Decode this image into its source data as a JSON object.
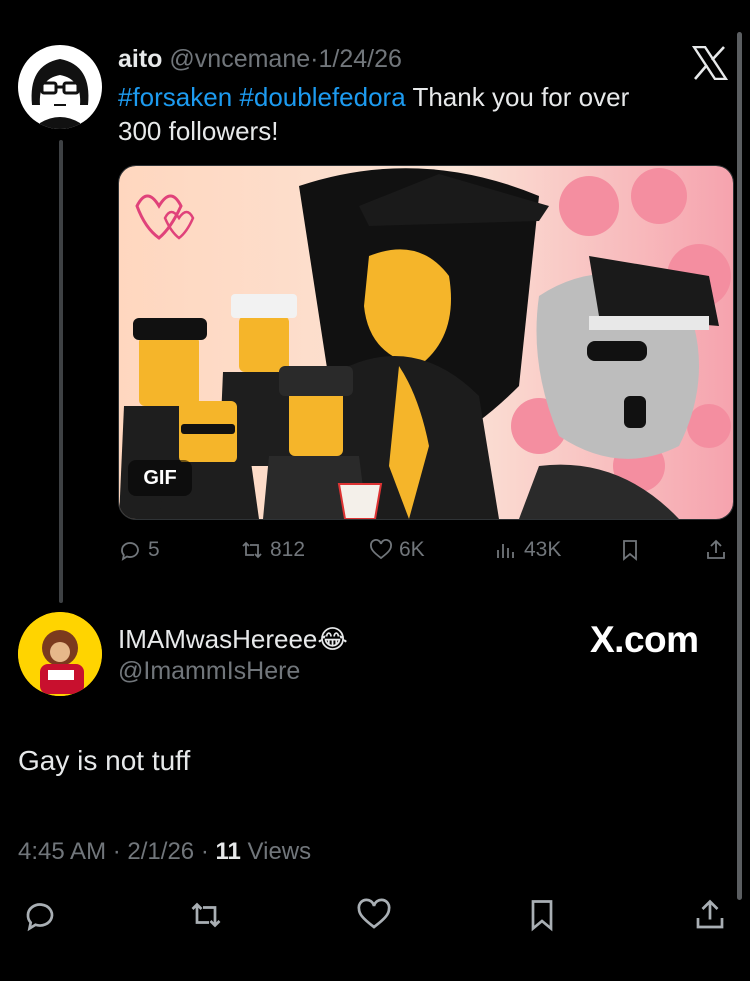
{
  "quoted_tweet": {
    "author_name": "aito",
    "handle": "@vncemane",
    "separator": "·",
    "date": "1/24/26",
    "hashtags": [
      "#forsaken",
      "#doublefedora"
    ],
    "text": "Thank you for over",
    "text_line2": "300 followers!",
    "media": {
      "badge": "GIF"
    },
    "stats": {
      "replies": "5",
      "reposts": "812",
      "likes": "6K",
      "views": "43K"
    }
  },
  "reply_tweet": {
    "author_name": "IMAMwasHereee😂",
    "handle": "@ImammIsHere",
    "brand": "X.com",
    "text": "Gay is not tuff",
    "time": "4:45 AM",
    "separator": "·",
    "date": "2/1/26",
    "views_count": "11",
    "views_label": "Views"
  },
  "colors": {
    "background": "#000000",
    "link": "#1d9bf0",
    "muted": "#71767b"
  }
}
